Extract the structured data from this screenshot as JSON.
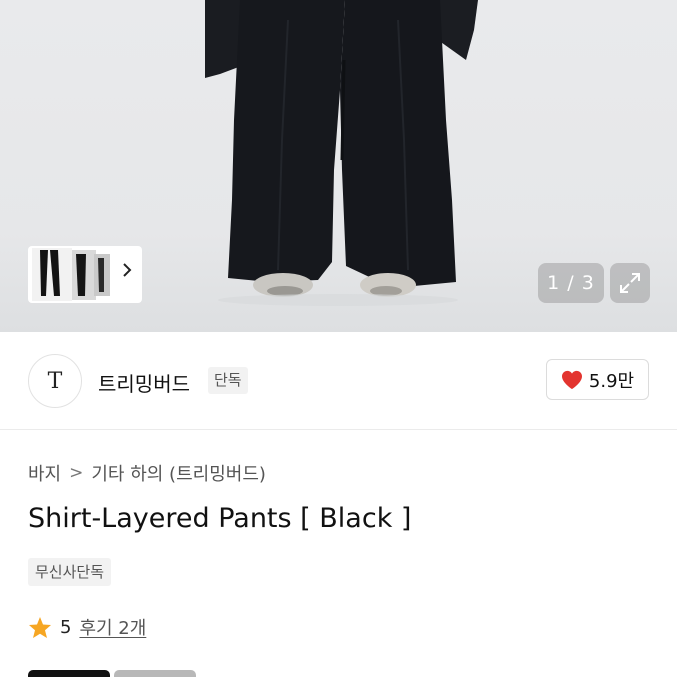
{
  "gallery": {
    "counter": "1 / 3",
    "thumbnail_count": 3
  },
  "icons": {
    "thumb_next": "chevron-right-icon",
    "expand": "expand-icon",
    "like": "heart-icon",
    "rating": "star-icon",
    "breadcrumb_separator": "chevron-right-icon"
  },
  "brand": {
    "logo_text": "T",
    "name": "트리밍버드",
    "badge": "단독"
  },
  "likes": {
    "count": "5.9만"
  },
  "breadcrumb": {
    "level1": "바지",
    "separator": ">",
    "level2": "기타 하의 (트리밍버드)"
  },
  "product": {
    "title": "Shirt-Layered Pants [ Black ]",
    "tag": "무신사단독"
  },
  "rating": {
    "score": "5",
    "reviews_label": "후기 2개"
  },
  "colors": {
    "heart": "#e3342f",
    "star": "#f6a623",
    "pants": "#15171c"
  }
}
